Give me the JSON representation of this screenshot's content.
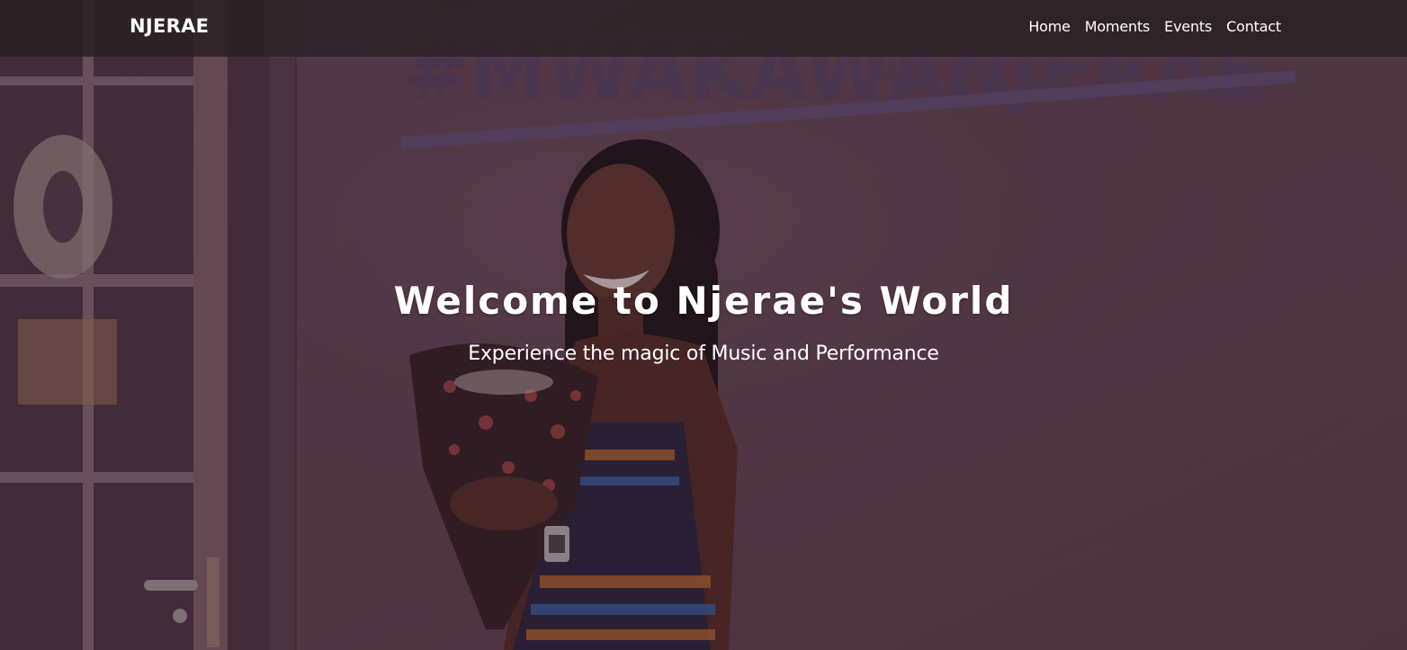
{
  "navbar": {
    "brand": "NJERAE",
    "links": [
      {
        "label": "Home"
      },
      {
        "label": "Moments"
      },
      {
        "label": "Events"
      },
      {
        "label": "Contact"
      }
    ]
  },
  "hero": {
    "title": "Welcome to Njerae's World",
    "subtitle": "Experience the magic of Music and Performance",
    "background_image": "performer-holding-flower-bouquet-photo",
    "overlay_color": "#3b2632"
  },
  "colors": {
    "navbar_bg": "#2b2124",
    "text": "#ffffff",
    "wall": "#6b4a58"
  }
}
